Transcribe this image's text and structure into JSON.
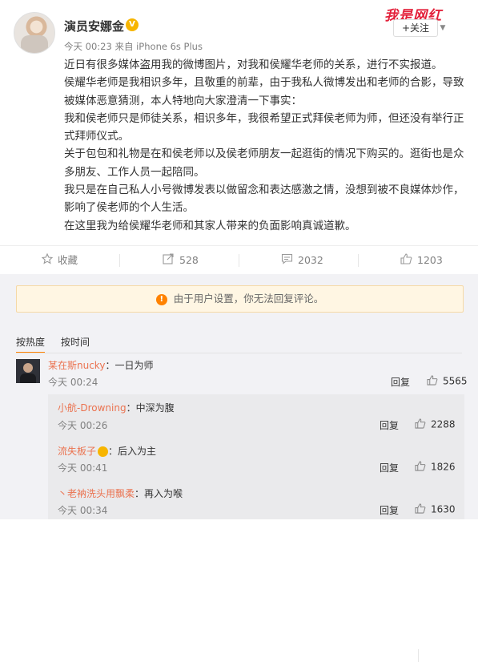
{
  "post": {
    "username": "演员安娜金",
    "vip_badge": "V",
    "time": "今天 00:23",
    "source_prefix": "来自",
    "source": "iPhone 6s Plus",
    "follow_label": "+关注",
    "watermark": "我是网红",
    "paragraphs": [
      "近日有很多媒体盗用我的微博图片，对我和侯耀华老师的关系，进行不实报道。",
      "侯耀华老师是我相识多年，且敬重的前辈，由于我私人微博发出和老师的合影，导致被媒体恶意猜测，本人特地向大家澄清一下事实：",
      "我和侯老师只是师徒关系，相识多年，我很希望正式拜侯老师为师，但还没有举行正式拜师仪式。",
      "关于包包和礼物是在和侯老师以及侯老师朋友一起逛街的情况下购买的。逛街也是众多朋友、工作人员一起陪同。",
      "我只是在自己私人小号微博发表以做留念和表达感激之情，没想到被不良媒体炒作，影响了侯老师的个人生活。",
      "在这里我为给侯耀华老师和其家人带来的负面影响真诚道歉。"
    ]
  },
  "actions": {
    "favorite": {
      "label": "收藏",
      "icon": "star-icon"
    },
    "repost": {
      "count": "528",
      "icon": "repost-icon"
    },
    "comment": {
      "count": "2032",
      "icon": "comment-icon"
    },
    "like": {
      "count": "1203",
      "icon": "thumbs-up-icon"
    }
  },
  "comments_section": {
    "notice": "由于用户设置，你无法回复评论。",
    "sort_hot": "按热度",
    "sort_time": "按时间",
    "reply_label": "回复",
    "top_comment": {
      "user": "某在斯nucky",
      "text": "：一日为师",
      "time": "今天 00:24",
      "likes": "5565"
    },
    "replies": [
      {
        "user": "小航-Drowning",
        "text": "：中深为腹",
        "time": "今天 00:26",
        "likes": "2288"
      },
      {
        "user": "流失板子",
        "text": "：后入为主",
        "time": "今天 00:41",
        "likes": "1826"
      },
      {
        "user": "丶老衲洗头用飘柔",
        "text": "：再入为喉",
        "time": "今天 00:34",
        "likes": "1630"
      }
    ]
  }
}
